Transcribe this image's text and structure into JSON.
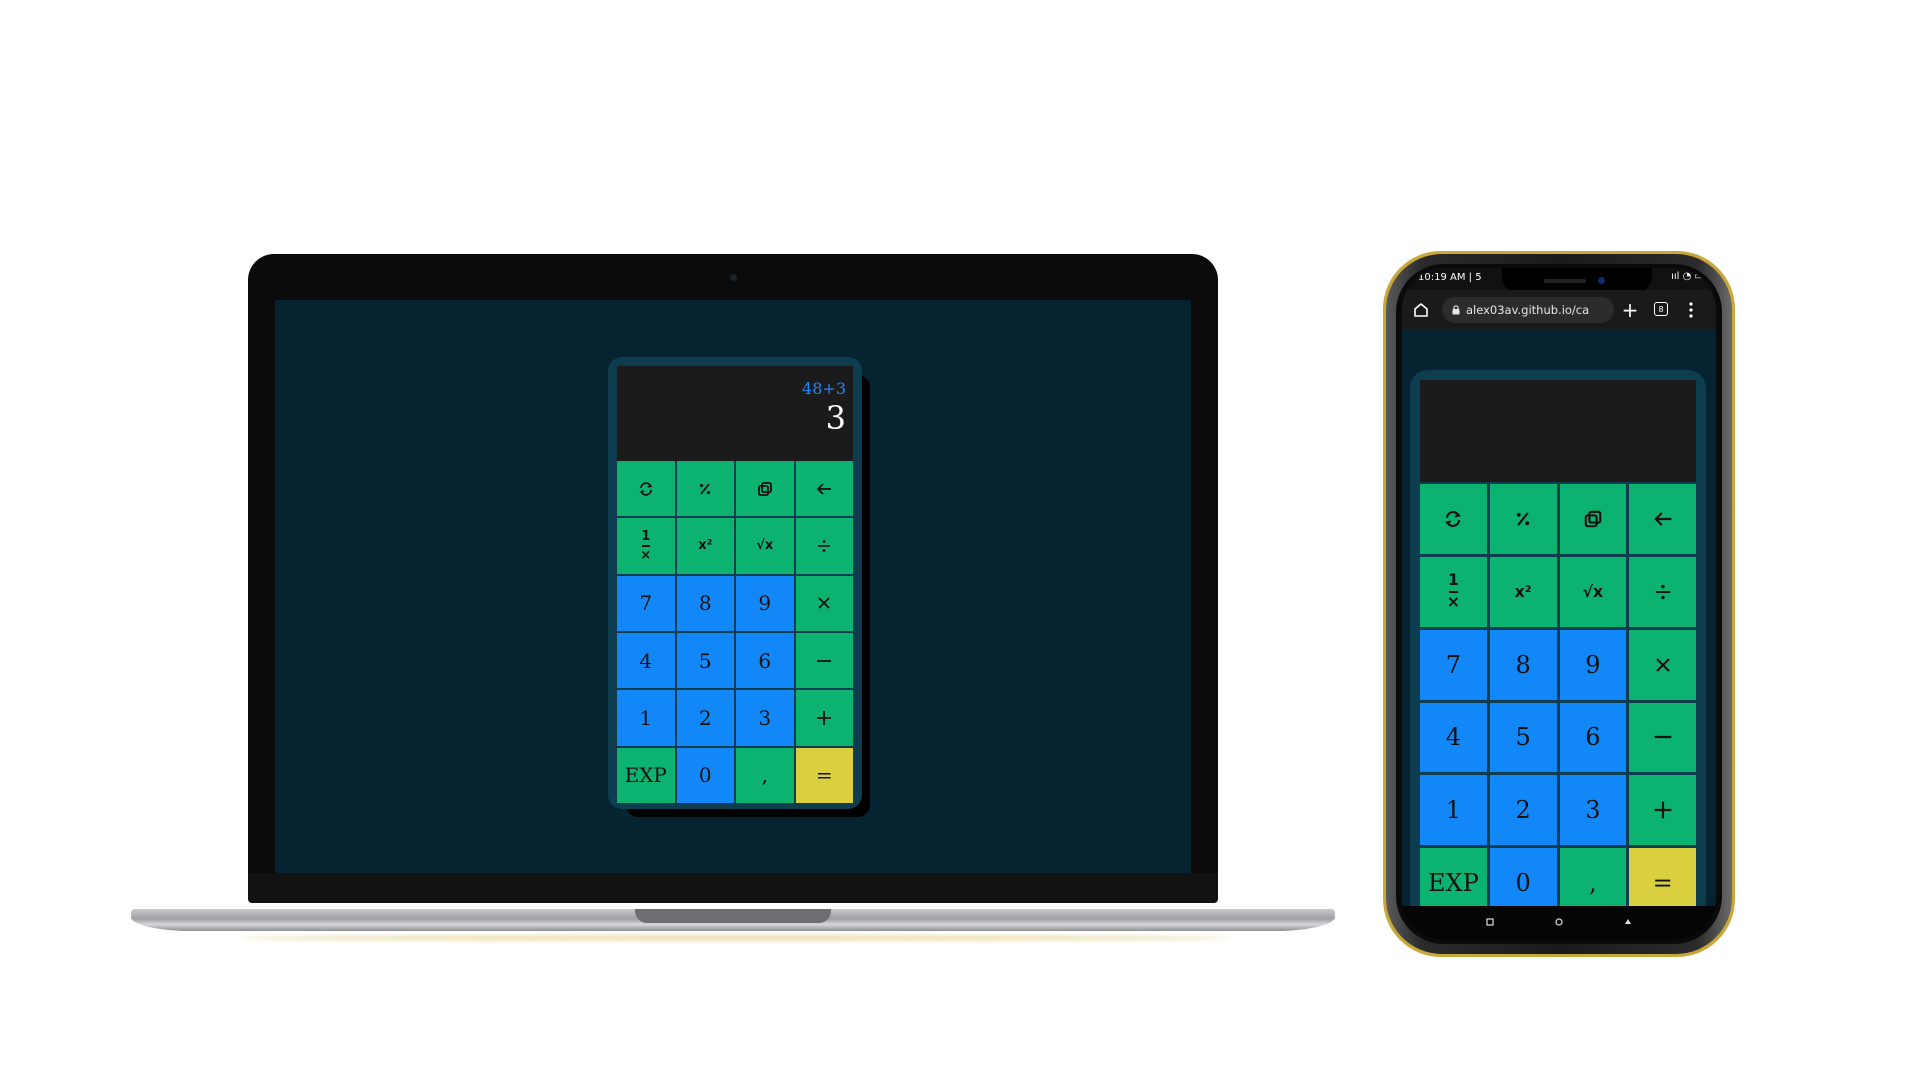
{
  "calculator": {
    "expression": "48+3",
    "result": "3",
    "keys": [
      {
        "label": "",
        "icon": "refresh-icon",
        "color": "green"
      },
      {
        "label": "%",
        "icon": "percent-icon",
        "color": "green"
      },
      {
        "label": "",
        "icon": "copy-icon",
        "color": "green"
      },
      {
        "label": "←",
        "icon": "backspace-icon",
        "color": "green"
      },
      {
        "label": "1/x",
        "icon": "reciprocal-icon",
        "color": "green"
      },
      {
        "label": "x²",
        "icon": "square-icon",
        "color": "green"
      },
      {
        "label": "√x",
        "icon": "sqrt-icon",
        "color": "green"
      },
      {
        "label": "÷",
        "icon": "divide-icon",
        "color": "green"
      },
      {
        "label": "7",
        "color": "blue"
      },
      {
        "label": "8",
        "color": "blue"
      },
      {
        "label": "9",
        "color": "blue"
      },
      {
        "label": "×",
        "icon": "multiply-icon",
        "color": "green"
      },
      {
        "label": "4",
        "color": "blue"
      },
      {
        "label": "5",
        "color": "blue"
      },
      {
        "label": "6",
        "color": "blue"
      },
      {
        "label": "−",
        "icon": "minus-icon",
        "color": "green"
      },
      {
        "label": "1",
        "color": "blue"
      },
      {
        "label": "2",
        "color": "blue"
      },
      {
        "label": "3",
        "color": "blue"
      },
      {
        "label": "+",
        "icon": "plus-icon",
        "color": "green"
      },
      {
        "label": "EXP",
        "color": "green"
      },
      {
        "label": "0",
        "color": "blue"
      },
      {
        "label": ",",
        "color": "green"
      },
      {
        "label": "=",
        "color": "yellow"
      }
    ]
  },
  "phone": {
    "status_time": "10:19 AM | 5",
    "status_icons": "ııl ◔ ▭",
    "url": "alex03av.github.io/ca",
    "tabs_count": "8"
  },
  "colors": {
    "page_bg": "#052331",
    "calc_body": "#0e3d50",
    "display_bg": "#1b1b1b",
    "green": "#0cb270",
    "blue": "#1287f7",
    "yellow": "#d9cf3f",
    "expression": "#1e88ff"
  }
}
